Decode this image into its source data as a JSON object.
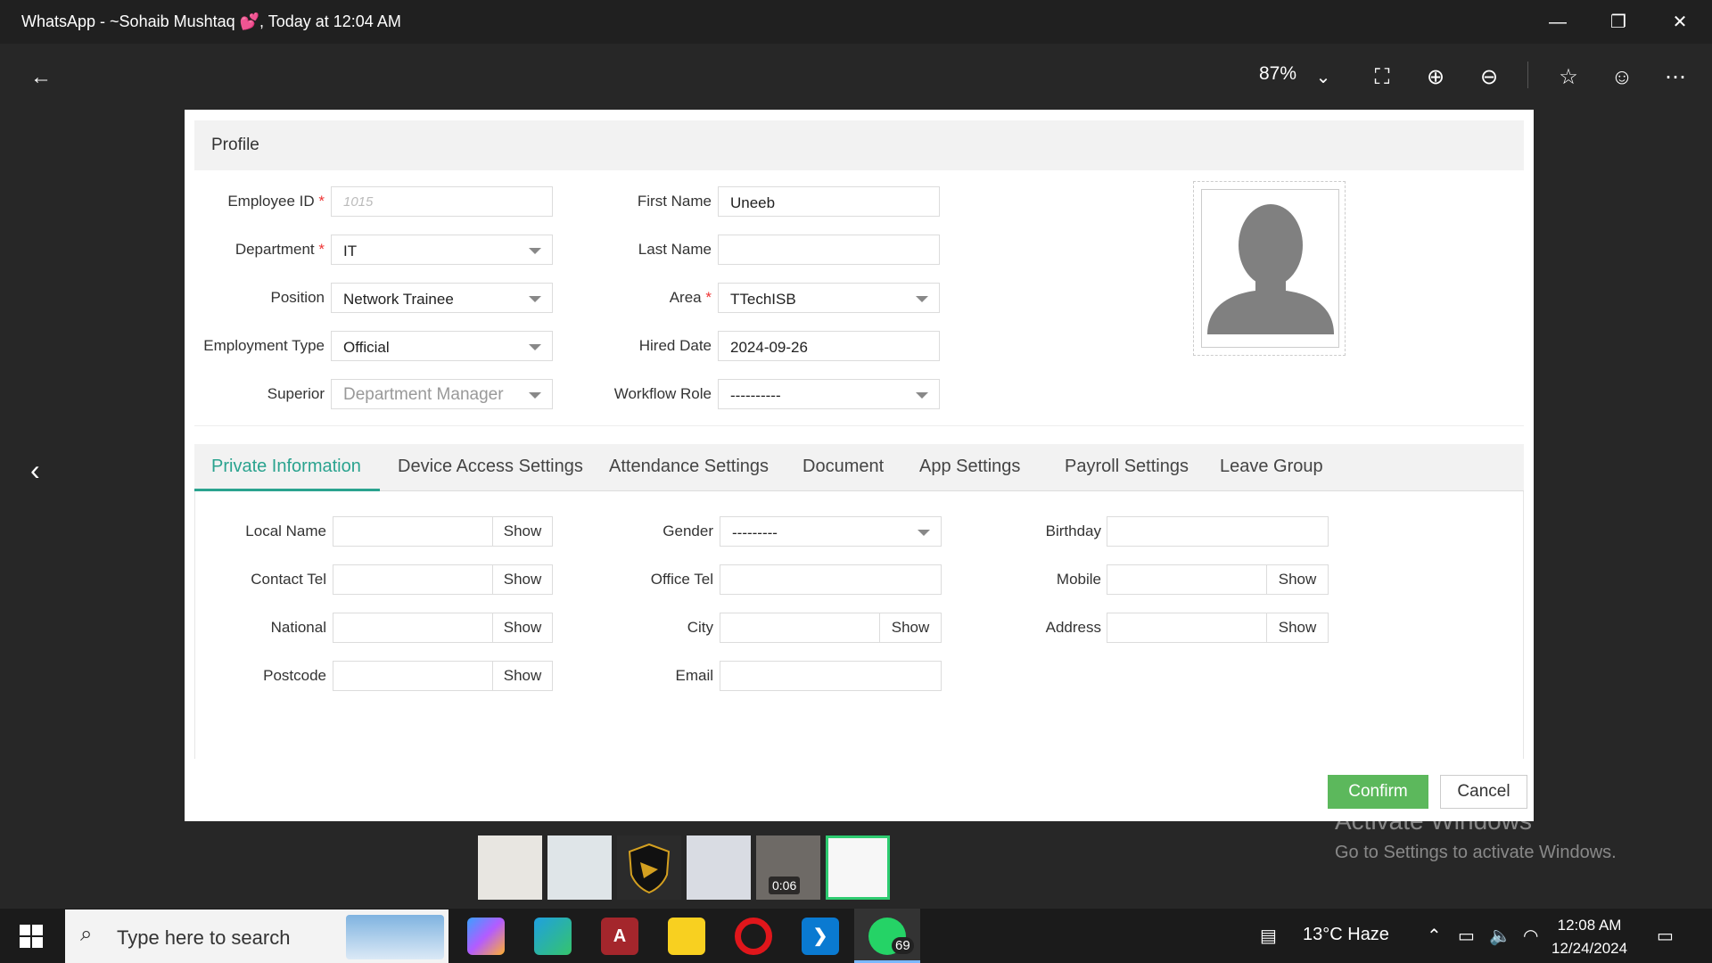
{
  "window": {
    "title": "WhatsApp - ~Sohaib Mushtaq 💕, Today at 12:04 AM",
    "minimize": "—",
    "restore": "❐",
    "close": "✕"
  },
  "toolbar": {
    "back": "←",
    "zoom_level": "87%",
    "zoom_caret": "⌄",
    "fit_icon": "⛶",
    "zoom_in_icon": "⊕",
    "zoom_out_icon": "⊖",
    "star_icon": "☆",
    "emoji_icon": "☺",
    "more_icon": "⋯"
  },
  "viewer": {
    "prev": "‹"
  },
  "profile": {
    "header": "Profile",
    "employee_id": {
      "label": "Employee ID",
      "required": "*",
      "placeholder": "1015"
    },
    "department": {
      "label": "Department",
      "required": "*",
      "value": "IT"
    },
    "position": {
      "label": "Position",
      "value": "Network Trainee"
    },
    "employment_type": {
      "label": "Employment Type",
      "value": "Official"
    },
    "superior": {
      "label": "Superior",
      "value": "Department Manager"
    },
    "first_name": {
      "label": "First Name",
      "value": "Uneeb"
    },
    "last_name": {
      "label": "Last Name",
      "value": ""
    },
    "area": {
      "label": "Area",
      "required": "*",
      "value": "TTechISB"
    },
    "hired_date": {
      "label": "Hired Date",
      "value": "2024-09-26"
    },
    "workflow_role": {
      "label": "Workflow Role",
      "value": "----------"
    }
  },
  "tabs": [
    {
      "label": "Private Information"
    },
    {
      "label": "Device Access Settings"
    },
    {
      "label": "Attendance Settings"
    },
    {
      "label": "Document"
    },
    {
      "label": "App Settings"
    },
    {
      "label": "Payroll Settings"
    },
    {
      "label": "Leave Group"
    }
  ],
  "private": {
    "show": "Show",
    "local_name": "Local Name",
    "contact_tel": "Contact Tel",
    "national": "National",
    "postcode": "Postcode",
    "gender": "Gender",
    "gender_value": "---------",
    "office_tel": "Office Tel",
    "city": "City",
    "email": "Email",
    "birthday": "Birthday",
    "mobile": "Mobile",
    "address": "Address"
  },
  "actions": {
    "confirm": "Confirm",
    "cancel": "Cancel"
  },
  "thumbnails": {
    "video_duration": "0:06"
  },
  "activation": {
    "line1": "Activate Windows",
    "line2": "Go to Settings to activate Windows."
  },
  "taskbar": {
    "search_placeholder": "Type here to search",
    "whatsapp_badge": "69",
    "weather": "13°C  Haze",
    "time": "12:08 AM",
    "date": "12/24/2024"
  },
  "colors": {
    "accent": "#2aa38f",
    "confirm": "#5cb85c",
    "required": "#ee3333"
  }
}
